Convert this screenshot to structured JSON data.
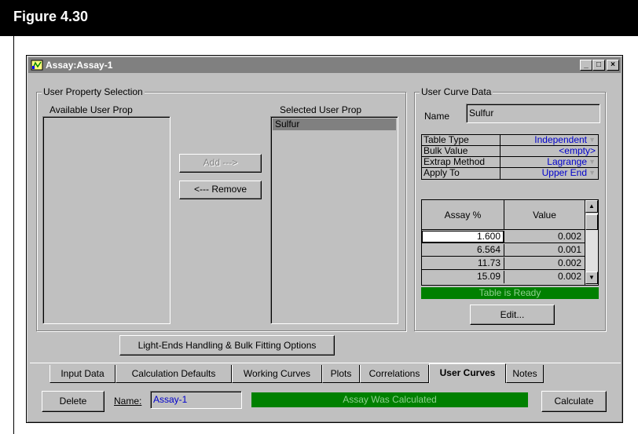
{
  "figure": {
    "title": "Figure 4.30"
  },
  "window": {
    "title": "Assay:Assay-1",
    "minimize": "_",
    "maximize": "□",
    "close": "×"
  },
  "user_property_selection": {
    "label": "User Property Selection",
    "available_label": "Available User Prop",
    "selected_label": "Selected User Prop",
    "available_items": [],
    "selected_items": [
      "Sulfur"
    ],
    "add_button": "Add --->",
    "remove_button": "<--- Remove"
  },
  "user_curve_data": {
    "label": "User Curve Data",
    "name_label": "Name",
    "name_value": "Sulfur",
    "properties": [
      {
        "key": "Table Type",
        "value": "Independent",
        "dropdown": true
      },
      {
        "key": "Bulk Value",
        "value": "<empty>",
        "dropdown": false
      },
      {
        "key": "Extrap Method",
        "value": "Lagrange",
        "dropdown": true
      },
      {
        "key": "Apply To",
        "value": "Upper End",
        "dropdown": true
      }
    ],
    "table": {
      "columns": [
        "Assay %",
        "Value"
      ],
      "rows": [
        [
          "1.600",
          "0.002"
        ],
        [
          "6.564",
          "0.001"
        ],
        [
          "11.73",
          "0.002"
        ],
        [
          "15.09",
          "0.002"
        ]
      ]
    },
    "table_status": "Table is Ready",
    "edit_button": "Edit..."
  },
  "light_ends_button": "Light-Ends Handling & Bulk Fitting Options",
  "tabs": [
    {
      "label": "Input Data",
      "active": false
    },
    {
      "label": "Calculation Defaults",
      "active": false
    },
    {
      "label": "Working Curves",
      "active": false
    },
    {
      "label": "Plots",
      "active": false
    },
    {
      "label": "Correlations",
      "active": false
    },
    {
      "label": "User Curves",
      "active": true
    },
    {
      "label": "Notes",
      "active": false
    }
  ],
  "footer": {
    "delete_button": "Delete",
    "name_label": "Name:",
    "name_value": "Assay-1",
    "status": "Assay Was Calculated",
    "calculate_button": "Calculate"
  },
  "colors": {
    "status_green": "#008000",
    "link_blue": "#0000cc",
    "face": "#c0c0c0"
  }
}
